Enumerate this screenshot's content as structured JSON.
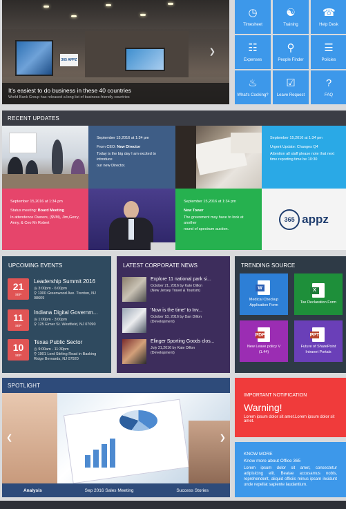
{
  "hero": {
    "title": "It's easiest to do business in these 40 countries",
    "subtitle": "World Bank Group has released a long list of business-friendly countries",
    "logo_text": "365 APPZ"
  },
  "quick_links": [
    {
      "label": "Timesheet",
      "icon": "timesheet-icon"
    },
    {
      "label": "Training",
      "icon": "training-icon"
    },
    {
      "label": "Help Desk",
      "icon": "help-desk-icon"
    },
    {
      "label": "Expenses",
      "icon": "expenses-icon"
    },
    {
      "label": "People Finder",
      "icon": "people-finder-icon"
    },
    {
      "label": "Policies",
      "icon": "policies-icon"
    },
    {
      "label": "What's Cooking?",
      "icon": "cooking-icon"
    },
    {
      "label": "Leave Request",
      "icon": "leave-request-icon"
    },
    {
      "label": "FAQ",
      "icon": "faq-icon"
    }
  ],
  "recent_updates": {
    "header": "RECENT UPDATES",
    "tile2": {
      "date": "September 15,2016 at 1:34 pm",
      "heading_prefix": "From CEO: ",
      "heading": "New Director",
      "body1": "Today is the big day I am excited to introduce",
      "body2": "our new Director."
    },
    "tile4": {
      "date": "September 15,2016 at 1:34 pm",
      "heading": "Urgent Update: Changes Q4",
      "body": "Attention all staff please note that next time reporting time be 10:30"
    },
    "tile5": {
      "date": "September 15,2016 at 1:34 pm",
      "heading_prefix": "Status meeting: ",
      "heading": "Board Meeting",
      "body": "In attendence Owners, ($VM), Jim,Gerry,",
      "body2": "Anny, & Ceo Mr Robert"
    },
    "tile7": {
      "date": "September 15,2016 at 1:34 pm",
      "heading": "New Tower",
      "body": "The greenment may have to look at another",
      "body2": "round of spectrum auction."
    },
    "tile8": {
      "logo_num": "365",
      "logo_text": "appz"
    }
  },
  "events": {
    "header": "UPCOMING EVENTS",
    "items": [
      {
        "day": "21",
        "month": "SEP",
        "title": "Leadership Summit 2016",
        "time": "3:00pm - 6:00pm",
        "address": "1300 Greenwood Ave. Trenton, NJ 08609"
      },
      {
        "day": "11",
        "month": "SEP",
        "title": "Indiana Digital Governm...",
        "time": "1:00pm - 3:00pm",
        "address": "125 Elmer St. Westfield, NJ 07090"
      },
      {
        "day": "10",
        "month": "SEP",
        "title": "Texas Public Sector",
        "time": "9:00am - 11:30pm",
        "address": "1901 Lord Stirling Road in Basking Ridge Bernards, NJ 07920"
      }
    ]
  },
  "news": {
    "header": "LATEST CORPORATE NEWS",
    "items": [
      {
        "title": "Explore 11 national park si...",
        "line1": "October 21, 2016 by Kate Dillon",
        "line2": "(New Jersey Travel & Tourism)"
      },
      {
        "title": "'Now is the time' to Inv...",
        "line1": "October 18, 2016 by Dan Dillon",
        "line2": "(Development)"
      },
      {
        "title": "Elinger Sporting Goods clos...",
        "line1": "July 21,2016 by Kate Dillon",
        "line2": "(Development)"
      }
    ]
  },
  "trending": {
    "header": "TRENDING SOURCE",
    "items": [
      {
        "label1": "Medical Checkup",
        "label2": "Application Form",
        "badge": "W",
        "color": "#2d7fd6"
      },
      {
        "label1": "Tax Declaration Form",
        "label2": "",
        "badge": "X",
        "color": "#1e8f3a"
      },
      {
        "label1": "New Leave policy V",
        "label2": "(1.44)",
        "badge": "PDF",
        "color": "#9b2db3"
      },
      {
        "label1": "Future of SharePoint",
        "label2": "Intranet Portals",
        "badge": "PPT",
        "color": "#6a3fb8"
      }
    ]
  },
  "spotlight": {
    "header": "SPOTLIGHT",
    "tabs": [
      "Analysis",
      "Sep 2016 Sales Meeting",
      "Success Stories"
    ]
  },
  "notification": {
    "header": "IMPORTANT NOTIFICATION",
    "title": "Warning!",
    "body": "Lorem ipsum dolor sit amet.Lorem ipsum dolor sit amet."
  },
  "know_more": {
    "header": "KNOW MORE",
    "title": "Know more about Office 365",
    "body": "Lorem ipsum dolor sit amet, consectetur adipisicing elit. Beatae accusamus nobis, reprehenderit, aliquid officiis minus ipsam incidunt unde repellat sapiente laudantium."
  },
  "colors": {
    "quick_link_blue": "#3d98ea",
    "panel_dark": "#2f4a5f",
    "news_purple": "#3d2d5c",
    "notification_red": "#f03b3b"
  }
}
